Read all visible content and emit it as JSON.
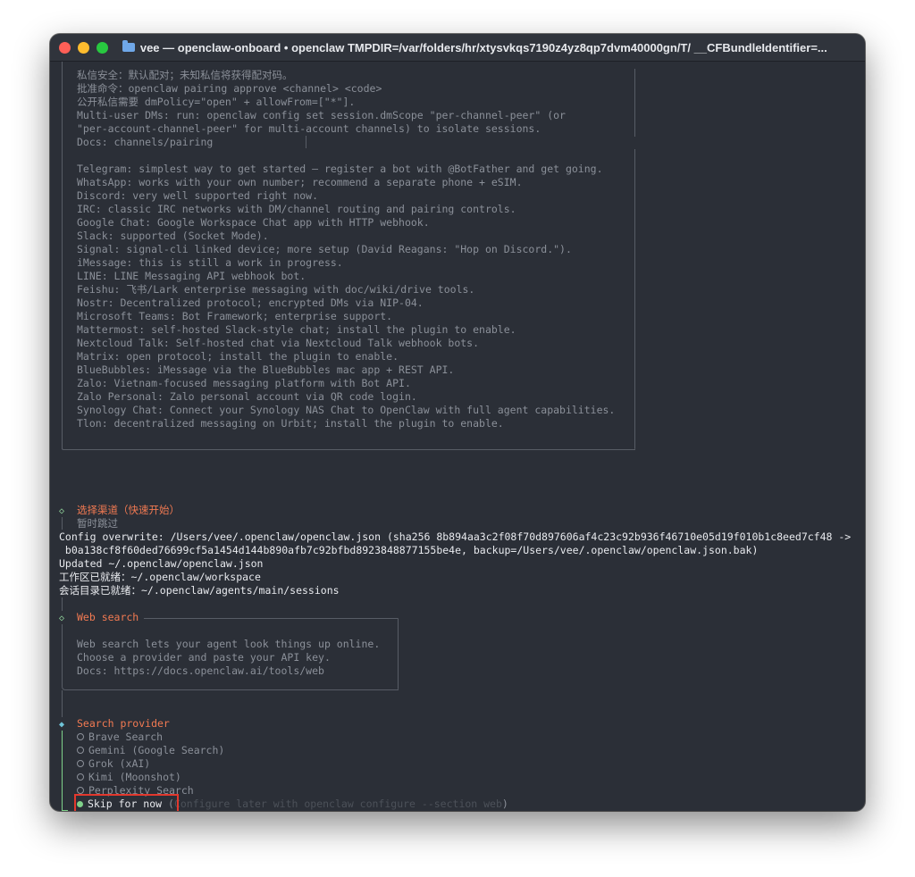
{
  "window": {
    "title": "vee — openclaw-onboard • openclaw TMPDIR=/var/folders/hr/xtysvkqs7190z4yz8qp7dvm40000gn/T/ __CFBundleIdentifier=..."
  },
  "dm_security": [
    "私信安全：默认配对；未知私信将获得配对码。",
    "批准命令：openclaw pairing approve <channel> <code>",
    "公开私信需要 dmPolicy=\"open\" + allowFrom=[\"*\"].",
    "Multi-user DMs: run: openclaw config set session.dmScope \"per-channel-peer\" (or",
    "\"per-account-channel-peer\" for multi-account channels) to isolate sessions.",
    "Docs: channels/pairing"
  ],
  "channels": [
    "Telegram: simplest way to get started — register a bot with @BotFather and get going.",
    "WhatsApp: works with your own number; recommend a separate phone + eSIM.",
    "Discord: very well supported right now.",
    "IRC: classic IRC networks with DM/channel routing and pairing controls.",
    "Google Chat: Google Workspace Chat app with HTTP webhook.",
    "Slack: supported (Socket Mode).",
    "Signal: signal-cli linked device; more setup (David Reagans: \"Hop on Discord.\").",
    "iMessage: this is still a work in progress.",
    "LINE: LINE Messaging API webhook bot.",
    "Feishu: 飞书/Lark enterprise messaging with doc/wiki/drive tools.",
    "Nostr: Decentralized protocol; encrypted DMs via NIP-04.",
    "Microsoft Teams: Bot Framework; enterprise support.",
    "Mattermost: self-hosted Slack-style chat; install the plugin to enable.",
    "Nextcloud Talk: Self-hosted chat via Nextcloud Talk webhook bots.",
    "Matrix: open protocol; install the plugin to enable.",
    "BlueBubbles: iMessage via the BlueBubbles mac app + REST API.",
    "Zalo: Vietnam-focused messaging platform with Bot API.",
    "Zalo Personal: Zalo personal account via QR code login.",
    "Synology Chat: Connect your Synology NAS Chat to OpenClaw with full agent capabilities.",
    "Tlon: decentralized messaging on Urbit; install the plugin to enable."
  ],
  "select_channel": {
    "title": "选择渠道（快速开始）",
    "value": "暂时跳过"
  },
  "log": [
    "Config overwrite: /Users/vee/.openclaw/openclaw.json (sha256 8b894aa3c2f08f70d897606af4c23c92b936f46710e05d19f010b1c8eed7cf48 ->",
    " b0a138cf8f60ded76699cf5a1454d144b890afb7c92bfbd8923848877155be4e, backup=/Users/vee/.openclaw/openclaw.json.bak)",
    "Updated ~/.openclaw/openclaw.json",
    "工作区已就绪：~/.openclaw/workspace",
    "会话目录已就绪：~/.openclaw/agents/main/sessions"
  ],
  "web_search": {
    "title": "Web search",
    "lines": [
      "Web search lets your agent look things up online.",
      "Choose a provider and paste your API key.",
      "Docs: https://docs.openclaw.ai/tools/web"
    ]
  },
  "search_provider": {
    "title": "Search provider",
    "options": [
      "Brave Search",
      "Gemini (Google Search)",
      "Grok (xAI)",
      "Kimi (Moonshot)",
      "Perplexity Search"
    ],
    "selected_label": "Skip for now",
    "selected_hint_open": " (",
    "selected_hint": "Configure later with openclaw configure --section web",
    "selected_hint_close": ")"
  },
  "colors": {
    "terminal_bg": "#2b2f37",
    "accent_orange": "#f27a52",
    "accent_green": "#7fd18a",
    "highlight_red": "#e2382d"
  }
}
